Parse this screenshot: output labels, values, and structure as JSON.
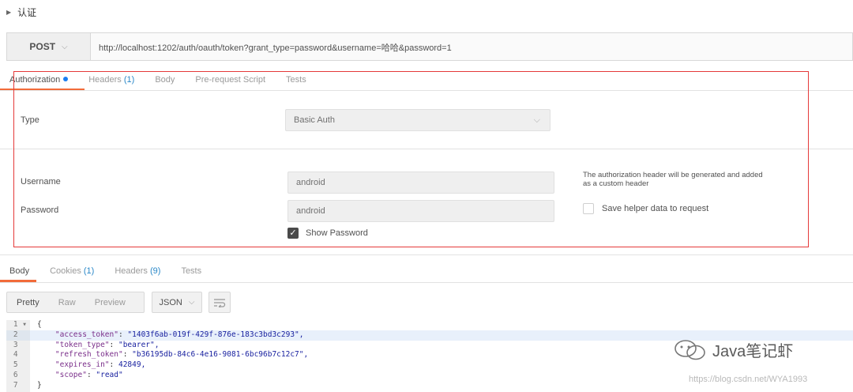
{
  "section": {
    "title": "认证"
  },
  "request": {
    "method": "POST",
    "url": "http://localhost:1202/auth/oauth/token?grant_type=password&username=哈哈&password=1"
  },
  "request_tabs": [
    {
      "label": "Authorization",
      "count": "",
      "active": true
    },
    {
      "label": "Headers",
      "count": "(1)",
      "active": false
    },
    {
      "label": "Body",
      "count": "",
      "active": false
    },
    {
      "label": "Pre-request Script",
      "count": "",
      "active": false
    },
    {
      "label": "Tests",
      "count": "",
      "active": false
    }
  ],
  "auth": {
    "type_label": "Type",
    "type_value": "Basic Auth",
    "username_label": "Username",
    "username_value": "android",
    "password_label": "Password",
    "password_value": "android",
    "show_password_label": "Show Password",
    "note": "The authorization header will be generated and added as a custom header",
    "save_helper_label": "Save helper data to request"
  },
  "response_tabs": [
    {
      "label": "Body",
      "count": "",
      "active": true
    },
    {
      "label": "Cookies",
      "count": "(1)",
      "active": false
    },
    {
      "label": "Headers",
      "count": "(9)",
      "active": false
    },
    {
      "label": "Tests",
      "count": "",
      "active": false
    }
  ],
  "view_modes": [
    "Pretty",
    "Raw",
    "Preview"
  ],
  "format": "JSON",
  "code_lines": [
    {
      "num": "1",
      "text": "{"
    },
    {
      "num": "2",
      "text": "    \"access_token\": \"1403f6ab-019f-429f-876e-183c3bd3c293\","
    },
    {
      "num": "3",
      "text": "    \"token_type\": \"bearer\","
    },
    {
      "num": "4",
      "text": "    \"refresh_token\": \"b36195db-84c6-4e16-9081-6bc96b7c12c7\","
    },
    {
      "num": "5",
      "text": "    \"expires_in\": 42849,"
    },
    {
      "num": "6",
      "text": "    \"scope\": \"read\""
    },
    {
      "num": "7",
      "text": "}"
    }
  ],
  "watermark": {
    "name": "Java笔记虾",
    "url": "https://blog.csdn.net/WYA1993"
  },
  "colors": {
    "accent": "#f26b3a",
    "annotation": "#e53a3a",
    "link": "#2a88c8",
    "dot": "#1a7ef2"
  }
}
